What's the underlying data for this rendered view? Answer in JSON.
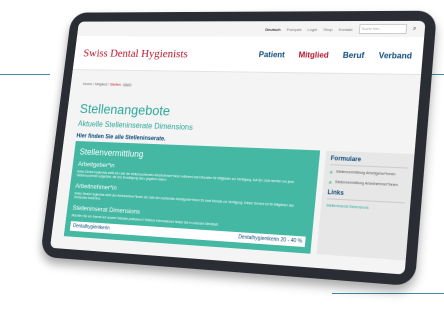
{
  "topbar": {
    "languages": [
      "Deutsch",
      "Français"
    ],
    "links": [
      "Login",
      "Shop",
      "Kontakt"
    ],
    "search_placeholder": "Suche hier..."
  },
  "header": {
    "logo_text": "Swiss Dental Hygienists",
    "nav": [
      "Patient",
      "Mitglied",
      "Beruf",
      "Verband"
    ]
  },
  "breadcrumb": {
    "home": "Home",
    "parent": "Mitglied",
    "current": "Stellen",
    "badge": "Intern"
  },
  "page": {
    "title": "Stellenangebote",
    "subtitle": "Aktuelle Stelleninserate Dimensions",
    "intro": "Hier finden Sie alle Stelleninserate."
  },
  "main": {
    "section_title": "Stellenvermittlung",
    "employer_title": "Arbeitgeber*in",
    "employer_text": "Swiss Dental Hygienists stellt die Liste der stellensuchenden Arbeitnehmer*innen während zwei Monaten für Mitglieder zur Verfügung. Auf der Liste werden nur jene Stellensuchende aufgeführt, die ihre Einwilligung dazu gegeben haben.",
    "employee_title": "Arbeitnehmer*in",
    "employee_text": "Swiss Dental Hygienists stellt den Arbeitnehmer*innen die Liste der suchenden Arbeitgeber*innen für zwei Monate zur Verfügung. Dieser Service ist für Mitglieder des Verbandes kostenlos.",
    "dimensions_title": "Stelleninserat Dimensions",
    "dimensions_text": "Möchten Sie ein Inserat auf unserer Website publizieren? Weitere Informationen finden Sie in unserem Merkblatt.",
    "job_left": "Dentalhygienikerin",
    "job_right": "Dentalhygienikerin 20 - 40 %"
  },
  "sidebar": {
    "title": "Formulare",
    "items": [
      "Stellenvermittlung Arbeitgeber*innen",
      "Stellenvermittlung Arbeitnehmer*innen"
    ],
    "links_title": "Links",
    "link": "Stelleninserat Dimensions"
  }
}
